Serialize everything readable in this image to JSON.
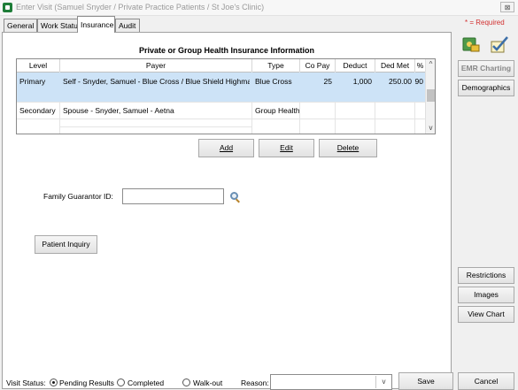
{
  "window": {
    "title": "Enter Visit (Samuel Snyder / Private Practice Patients / St Joe's Clinic)",
    "close_glyph": "⊠"
  },
  "tabs": [
    {
      "label": "General"
    },
    {
      "label": "Work Status"
    },
    {
      "label": "Insurance",
      "active": true
    },
    {
      "label": "Audit"
    }
  ],
  "required_note": "* = Required",
  "insurance": {
    "section_title": "Private or Group Health Insurance Information",
    "columns": [
      "Level",
      "Payer",
      "Type",
      "Co Pay",
      "Deduct",
      "Ded Met",
      "%"
    ],
    "rows": [
      {
        "level": "Primary",
        "payer": "Self - Snyder, Samuel - Blue Cross / Blue Shield Highmark",
        "type": "Blue Cross",
        "copay": "25",
        "deduct": "1,000",
        "dedmet": "250.00",
        "pct": "90",
        "selected": true
      },
      {
        "level": "Secondary",
        "payer": "Spouse - Snyder, Samuel - Aetna",
        "type": "Group Health",
        "copay": "",
        "deduct": "",
        "dedmet": "",
        "pct": "",
        "selected": false
      }
    ],
    "buttons": {
      "add": "Add",
      "edit": "Edit",
      "delete": "Delete"
    }
  },
  "guarantor": {
    "label": "Family Guarantor ID:",
    "value": ""
  },
  "patient_inquiry": "Patient Inquiry",
  "side_buttons": {
    "emr_charting": "EMR Charting",
    "demographics": "Demographics",
    "restrictions": "Restrictions",
    "images": "Images",
    "view_chart": "View Chart"
  },
  "footer": {
    "visit_status_label": "Visit Status:",
    "options": [
      {
        "label": "Pending Results",
        "selected": true
      },
      {
        "label": "Completed",
        "selected": false
      },
      {
        "label": "Walk-out",
        "selected": false
      }
    ],
    "reason_label": "Reason:",
    "reason_value": "",
    "save": "Save",
    "cancel": "Cancel"
  },
  "colors": {
    "selected_row": "#cde3f7",
    "required": "#d23030",
    "app_icon": "#1e7d38"
  }
}
